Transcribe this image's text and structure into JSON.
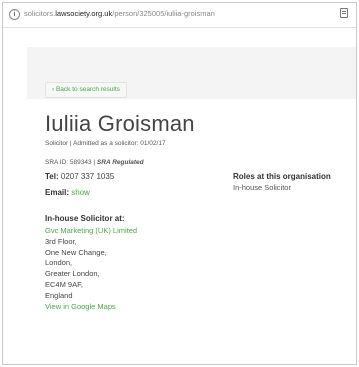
{
  "browser": {
    "url_prefix": "solicitors.",
    "url_domain": "lawsociety.org.uk",
    "url_path": "/person/325005/iuliia-groisman"
  },
  "page": {
    "back_link": "‹ Back to search results",
    "name": "Iuliia Groisman",
    "role_line": "Solicitor  |  Admitted as a solicitor: 01/02/17",
    "sra_id": "SRA ID: 589343  |  ",
    "sra_regulated": "SRA Regulated",
    "tel_label": "Tel:",
    "tel_value": " 0207 337 1035",
    "email_label": "Email:",
    "email_link": "show",
    "roles_title": "Roles at this organisation",
    "roles_value": "In-house Solicitor",
    "inhouse_title": "In-house Solicitor at:",
    "organisation": "Gvc Marketing (UK) Limited",
    "address": [
      "3rd Floor,",
      "One New Change,",
      "London,",
      "Greater London,",
      "EC4M 9AF,",
      "England"
    ],
    "map_link": "View in Google Maps"
  }
}
